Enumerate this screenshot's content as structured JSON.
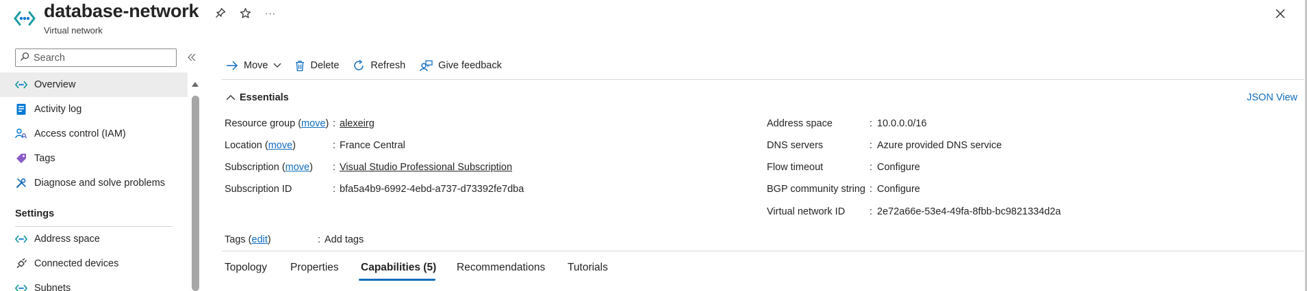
{
  "header": {
    "title": "database-network",
    "subtitle": "Virtual network",
    "more_label": "···"
  },
  "sidebar": {
    "search_placeholder": "Search",
    "items": [
      {
        "label": "Overview",
        "icon": "vnet-icon"
      },
      {
        "label": "Activity log",
        "icon": "activity-log-icon"
      },
      {
        "label": "Access control (IAM)",
        "icon": "iam-icon"
      },
      {
        "label": "Tags",
        "icon": "tag-icon"
      },
      {
        "label": "Diagnose and solve problems",
        "icon": "wrench-icon"
      }
    ],
    "settings_section": "Settings",
    "settings_items": [
      {
        "label": "Address space",
        "icon": "vnet-icon"
      },
      {
        "label": "Connected devices",
        "icon": "plug-icon"
      },
      {
        "label": "Subnets",
        "icon": "vnet-icon"
      }
    ]
  },
  "toolbar": {
    "move_label": "Move",
    "delete_label": "Delete",
    "refresh_label": "Refresh",
    "feedback_label": "Give feedback"
  },
  "essentials": {
    "label": "Essentials",
    "json_view": "JSON View",
    "left": {
      "resource_group_label": "Resource group",
      "resource_group_move": "move",
      "resource_group_value": "alexeirg",
      "location_label": "Location",
      "location_move": "move",
      "location_value": "France Central",
      "subscription_label": "Subscription",
      "subscription_move": "move",
      "subscription_value": "Visual Studio Professional Subscription",
      "subscription_id_label": "Subscription ID",
      "subscription_id_value": "bfa5a4b9-6992-4ebd-a737-d73392fe7dba"
    },
    "right": {
      "address_space_label": "Address space",
      "address_space_value": "10.0.0.0/16",
      "dns_label": "DNS servers",
      "dns_value": "Azure provided DNS service",
      "flow_timeout_label": "Flow timeout",
      "flow_timeout_value": "Configure",
      "bgp_label": "BGP community string",
      "bgp_value": "Configure",
      "vnet_id_label": "Virtual network ID",
      "vnet_id_value": "2e72a66e-53e4-49fa-8fbb-bc9821334d2a"
    },
    "tags_label": "Tags",
    "tags_edit": "edit",
    "tags_value": "Add tags"
  },
  "tabs": [
    {
      "label": "Topology"
    },
    {
      "label": "Properties"
    },
    {
      "label": "Capabilities (5)"
    },
    {
      "label": "Recommendations"
    },
    {
      "label": "Tutorials"
    }
  ],
  "colors": {
    "accent": "#0f6cbd",
    "vnet_teal": "#1a9ba1",
    "vnet_blue": "#0078d4"
  }
}
